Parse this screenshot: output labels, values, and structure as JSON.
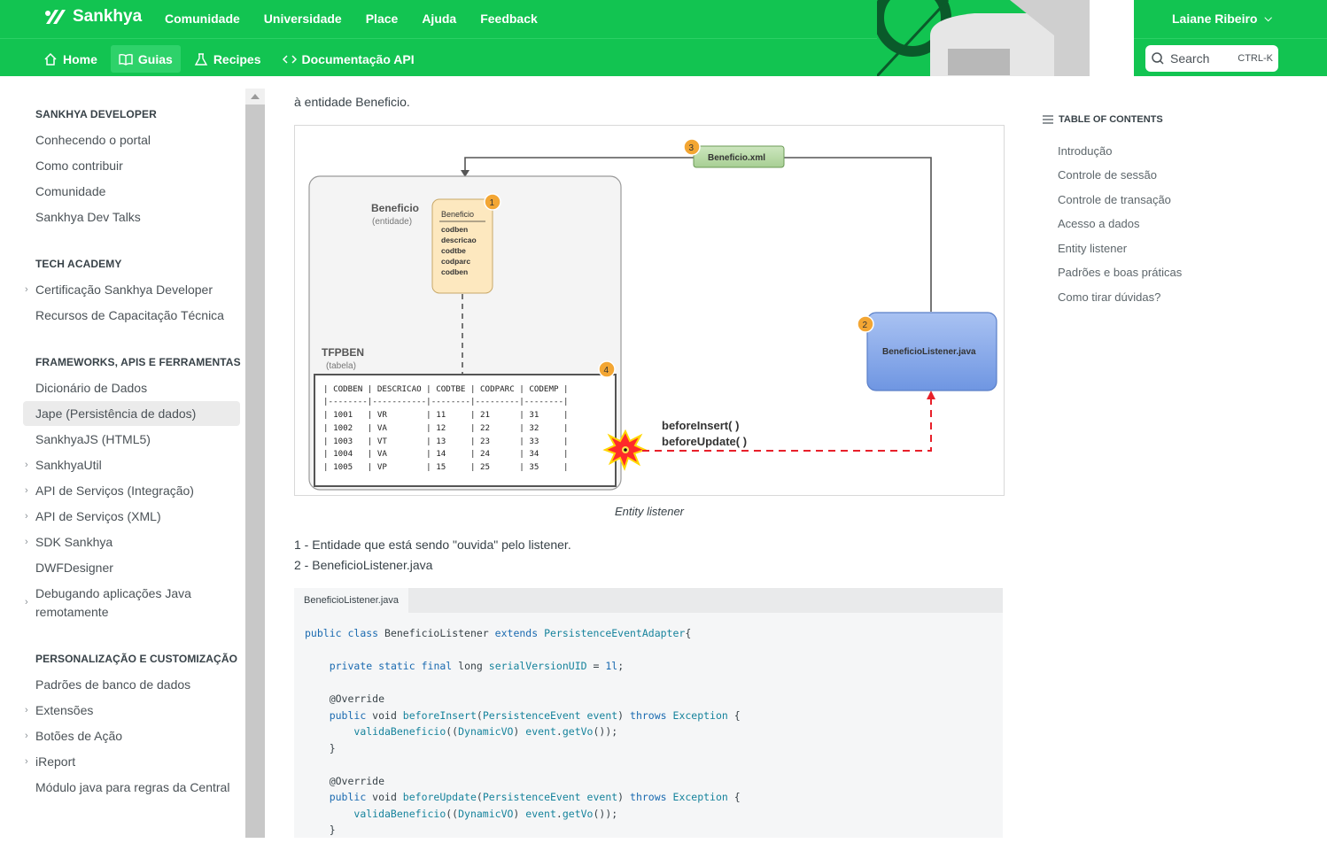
{
  "header": {
    "brand": "Sankhya",
    "top_nav": [
      "Comunidade",
      "Universidade",
      "Place",
      "Ajuda",
      "Feedback"
    ],
    "user_name": "Laiane Ribeiro",
    "sub_nav": [
      {
        "label": "Home",
        "icon": "home-icon"
      },
      {
        "label": "Guias",
        "icon": "book-icon",
        "active": true
      },
      {
        "label": "Recipes",
        "icon": "flask-icon"
      },
      {
        "label": "Documentação API",
        "icon": "code-icon"
      }
    ],
    "search": {
      "placeholder": "Search",
      "shortcut": "CTRL-K"
    },
    "accent_color": "#12c451"
  },
  "sidebar": {
    "sections": [
      {
        "title": "SANKHYA DEVELOPER",
        "items": [
          {
            "label": "Conhecendo o portal"
          },
          {
            "label": "Como contribuir"
          },
          {
            "label": "Comunidade"
          },
          {
            "label": "Sankhya Dev Talks"
          }
        ]
      },
      {
        "title": "TECH ACADEMY",
        "items": [
          {
            "label": "Certificação Sankhya Developer",
            "expandable": true
          },
          {
            "label": "Recursos de Capacitação Técnica"
          }
        ]
      },
      {
        "title": "FRAMEWORKS, APIS E FERRAMENTAS",
        "items": [
          {
            "label": "Dicionário de Dados"
          },
          {
            "label": "Jape (Persistência de dados)",
            "active": true
          },
          {
            "label": "SankhyaJS (HTML5)"
          },
          {
            "label": "SankhyaUtil",
            "expandable": true
          },
          {
            "label": "API de Serviços (Integração)",
            "expandable": true
          },
          {
            "label": "API de Serviços (XML)",
            "expandable": true
          },
          {
            "label": "SDK Sankhya",
            "expandable": true
          },
          {
            "label": "DWFDesigner"
          },
          {
            "label": "Debugando aplicações Java remotamente",
            "expandable": true
          }
        ]
      },
      {
        "title": "PERSONALIZAÇÃO E CUSTOMIZAÇÃO",
        "items": [
          {
            "label": "Padrões de banco de dados"
          },
          {
            "label": "Extensões",
            "expandable": true
          },
          {
            "label": "Botões de Ação",
            "expandable": true
          },
          {
            "label": "iReport",
            "expandable": true
          },
          {
            "label": "Módulo java para regras da Central"
          }
        ]
      }
    ]
  },
  "content": {
    "intro": "à entidade Beneficio.",
    "figure": {
      "caption": "Entity listener",
      "entity_title": "Beneficio",
      "entity_sub": "(entidade)",
      "entity_box_title": "Beneficio",
      "entity_fields": [
        "codben",
        "descricao",
        "codtbe",
        "codparc",
        "codben"
      ],
      "xml_label": "Beneficio.xml",
      "listener_label": "BeneficioListener.java",
      "table_title": "TFPBEN",
      "table_sub": "(tabela)",
      "table_header": "| CODBEN | DESCRICAO | CODTBE | CODPARC | CODEMP |",
      "table_sep": "|--------|-----------|--------|---------|--------|",
      "table_rows": [
        "| 1001   | VR        | 11     | 21      | 31     |",
        "| 1002   | VA        | 12     | 22      | 32     |",
        "| 1003   | VT        | 13     | 23      | 33     |",
        "| 1004   | VA        | 14     | 24      | 34     |",
        "| 1005   | VP        | 15     | 25      | 35     |"
      ],
      "event_1": "beforeInsert( )",
      "event_2": "beforeUpdate( )",
      "badges": [
        "1",
        "2",
        "3",
        "4"
      ]
    },
    "notes": [
      "1 - Entidade que está sendo \"ouvida\" pelo listener.",
      "2 - BeneficioListener.java"
    ],
    "code_tab": "BeneficioListener.java"
  },
  "toc": {
    "title": "TABLE OF CONTENTS",
    "items": [
      "Introdução",
      "Controle de sessão",
      "Controle de transação",
      "Acesso a dados",
      "Entity listener",
      "Padrões e boas práticas",
      "Como tirar dúvidas?"
    ]
  }
}
